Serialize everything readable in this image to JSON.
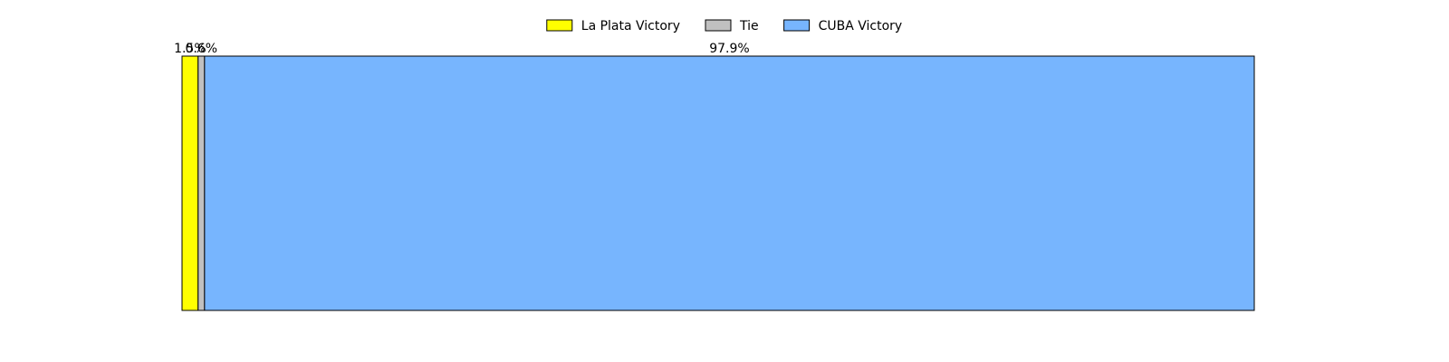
{
  "chart_data": {
    "type": "bar",
    "orientation": "horizontal-stacked",
    "categories": [
      ""
    ],
    "series": [
      {
        "name": "La Plata Victory",
        "values": [
          1.5
        ],
        "label": "1.5%",
        "color": "#ffff00"
      },
      {
        "name": "Tie",
        "values": [
          0.6
        ],
        "label": "0.6%",
        "color": "#c0c0c0"
      },
      {
        "name": "CUBA Victory",
        "values": [
          97.9
        ],
        "label": "97.9%",
        "color": "#77b5fe"
      }
    ],
    "xlim": [
      0,
      100
    ],
    "grid": false,
    "axes_visible": false,
    "legend": {
      "position": "top-center",
      "orientation": "horizontal"
    }
  }
}
